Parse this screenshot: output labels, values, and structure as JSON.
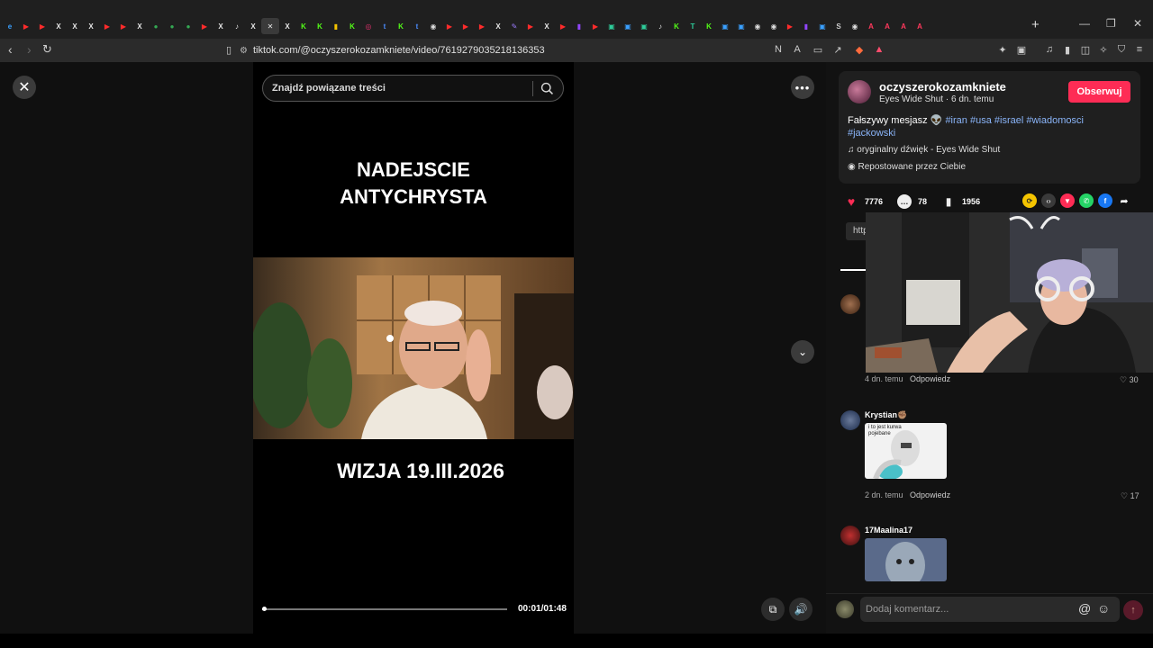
{
  "browser": {
    "url": "tiktok.com/@oczyszerokozamkniete/video/7619279035218136353",
    "tabs": [
      {
        "icon": "edge-icon",
        "glyph": "e",
        "color": "#3aa0ff"
      },
      {
        "icon": "youtube-icon",
        "glyph": "▶",
        "color": "#ff2b2b"
      },
      {
        "icon": "youtube-icon",
        "glyph": "▶",
        "color": "#ff2b2b"
      },
      {
        "icon": "x-icon",
        "glyph": "X",
        "color": "#e6e6e6"
      },
      {
        "icon": "x-icon",
        "glyph": "X",
        "color": "#e6e6e6"
      },
      {
        "icon": "x-icon",
        "glyph": "X",
        "color": "#e6e6e6"
      },
      {
        "icon": "youtube-icon",
        "glyph": "▶",
        "color": "#ff2b2b"
      },
      {
        "icon": "youtube-icon",
        "glyph": "▶",
        "color": "#ff2b2b"
      },
      {
        "icon": "x-icon",
        "glyph": "X",
        "color": "#e6e6e6"
      },
      {
        "icon": "maps-icon",
        "glyph": "●",
        "color": "#34a853"
      },
      {
        "icon": "maps-icon",
        "glyph": "●",
        "color": "#34a853"
      },
      {
        "icon": "maps-icon",
        "glyph": "●",
        "color": "#34a853"
      },
      {
        "icon": "youtube-icon",
        "glyph": "▶",
        "color": "#ff2b2b"
      },
      {
        "icon": "x-icon",
        "glyph": "X",
        "color": "#e6e6e6"
      },
      {
        "icon": "tiktok-icon",
        "glyph": "♪",
        "color": "#e6e6e6"
      },
      {
        "icon": "x-icon",
        "glyph": "X",
        "color": "#e6e6e6"
      },
      {
        "icon": "close-tab-icon",
        "glyph": "✕",
        "color": "#e6e6e6",
        "active": true
      },
      {
        "icon": "x-icon",
        "glyph": "X",
        "color": "#e6e6e6"
      },
      {
        "icon": "kick-icon",
        "glyph": "K",
        "color": "#53fc18"
      },
      {
        "icon": "kick-icon",
        "glyph": "K",
        "color": "#53fc18"
      },
      {
        "icon": "kick-icon",
        "glyph": "▮",
        "color": "#f5c400"
      },
      {
        "icon": "kick-icon",
        "glyph": "K",
        "color": "#53fc18"
      },
      {
        "icon": "instagram-icon",
        "glyph": "◎",
        "color": "#e1306c"
      },
      {
        "icon": "tipply-icon",
        "glyph": "t",
        "color": "#4a8cff"
      },
      {
        "icon": "kick-icon",
        "glyph": "K",
        "color": "#53fc18"
      },
      {
        "icon": "tipply-icon",
        "glyph": "t",
        "color": "#4a8cff"
      },
      {
        "icon": "chrome-icon",
        "glyph": "◉",
        "color": "#dddddd"
      },
      {
        "icon": "youtube-icon",
        "glyph": "▶",
        "color": "#ff2b2b"
      },
      {
        "icon": "youtube-icon",
        "glyph": "▶",
        "color": "#ff2b2b"
      },
      {
        "icon": "youtube-icon",
        "glyph": "▶",
        "color": "#ff2b2b"
      },
      {
        "icon": "x-icon",
        "glyph": "X",
        "color": "#e6e6e6"
      },
      {
        "icon": "feather-icon",
        "glyph": "✎",
        "color": "#9b7bff"
      },
      {
        "icon": "youtube-icon",
        "glyph": "▶",
        "color": "#ff2b2b"
      },
      {
        "icon": "x-icon",
        "glyph": "X",
        "color": "#e6e6e6"
      },
      {
        "icon": "youtube-icon",
        "glyph": "▶",
        "color": "#ff2b2b"
      },
      {
        "icon": "twitch-icon",
        "glyph": "▮",
        "color": "#9146ff"
      },
      {
        "icon": "youtube-icon",
        "glyph": "▶",
        "color": "#ff2b2b"
      },
      {
        "icon": "app-icon",
        "glyph": "▣",
        "color": "#2ecc9a"
      },
      {
        "icon": "app-icon",
        "glyph": "▣",
        "color": "#3aa0ff"
      },
      {
        "icon": "app-icon",
        "glyph": "▣",
        "color": "#2ecc9a"
      },
      {
        "icon": "tiktok-icon",
        "glyph": "♪",
        "color": "#e6e6e6"
      },
      {
        "icon": "kick-icon",
        "glyph": "K",
        "color": "#53fc18"
      },
      {
        "icon": "tt-icon",
        "glyph": "T",
        "color": "#2ecc9a"
      },
      {
        "icon": "kick-icon",
        "glyph": "K",
        "color": "#53fc18"
      },
      {
        "icon": "app-icon",
        "glyph": "▣",
        "color": "#3aa0ff"
      },
      {
        "icon": "app-icon",
        "glyph": "▣",
        "color": "#3aa0ff"
      },
      {
        "icon": "github-icon",
        "glyph": "◉",
        "color": "#dddddd"
      },
      {
        "icon": "chrome-icon",
        "glyph": "◉",
        "color": "#dddddd"
      },
      {
        "icon": "youtube-icon",
        "glyph": "▶",
        "color": "#ff2b2b"
      },
      {
        "icon": "twitch-icon",
        "glyph": "▮",
        "color": "#9146ff"
      },
      {
        "icon": "app-icon",
        "glyph": "▣",
        "color": "#3aa0ff"
      },
      {
        "icon": "app-icon",
        "glyph": "S",
        "color": "#cccccc"
      },
      {
        "icon": "chrome-icon",
        "glyph": "◉",
        "color": "#dddddd"
      },
      {
        "icon": "airbnb-icon",
        "glyph": "A",
        "color": "#ff385c"
      },
      {
        "icon": "airbnb-icon",
        "glyph": "A",
        "color": "#ff385c"
      },
      {
        "icon": "airbnb-icon",
        "glyph": "A",
        "color": "#ff385c"
      },
      {
        "icon": "airbnb-icon",
        "glyph": "A",
        "color": "#ff385c"
      }
    ]
  },
  "video": {
    "search_placeholder": "Znajdź powiązane treści",
    "title_line1": "NADEJSCIE",
    "title_line2": "ANTYCHRYSTA",
    "subtitle": "WIZJA 19.III.2026",
    "time": "00:01/01:48",
    "progress": 0.01
  },
  "post": {
    "username": "oczyszerokozamkniete",
    "meta": "Eyes Wide Shut · 6 dn. temu",
    "follow_label": "Obserwuj",
    "desc_text": "Fałszywy mesjasz 👽 ",
    "hashtags": [
      "#iran",
      "#usa",
      "#israel",
      "#wiadomosci",
      "#jackowski"
    ],
    "sound": "oryginalny dźwięk - Eyes Wide Shut",
    "repost": "Repostowane przez Ciebie",
    "likes": "7776",
    "comments": "78",
    "saves": "1956",
    "link_text": "http"
  },
  "comments": [
    {
      "name": "",
      "time": "4 dn. temu",
      "reply": "Odpowiedz",
      "likes": "30"
    },
    {
      "name": "Krystian✊🏽",
      "image_text": "i to jest kurwa pojebane",
      "time": "2 dn. temu",
      "reply": "Odpowiedz",
      "likes": "17"
    },
    {
      "name": "17Maalina17"
    }
  ],
  "composer": {
    "placeholder": "Dodaj komentarz..."
  },
  "colors": {
    "accent": "#fe2c55",
    "hashtag": "#8ab4f8"
  }
}
